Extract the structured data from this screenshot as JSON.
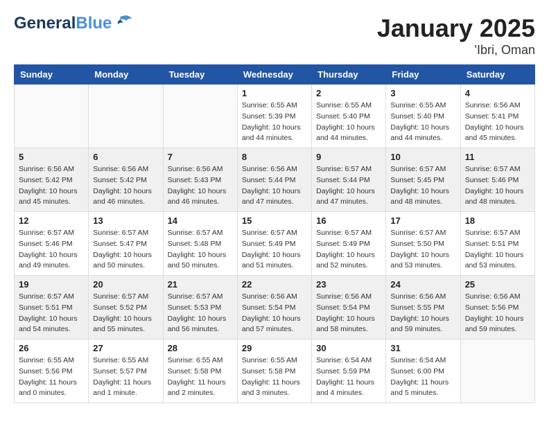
{
  "header": {
    "logo_general": "General",
    "logo_blue": "Blue",
    "month": "January 2025",
    "location": "'Ibri, Oman"
  },
  "weekdays": [
    "Sunday",
    "Monday",
    "Tuesday",
    "Wednesday",
    "Thursday",
    "Friday",
    "Saturday"
  ],
  "weeks": [
    [
      {
        "day": "",
        "info": ""
      },
      {
        "day": "",
        "info": ""
      },
      {
        "day": "",
        "info": ""
      },
      {
        "day": "1",
        "info": "Sunrise: 6:55 AM\nSunset: 5:39 PM\nDaylight: 10 hours\nand 44 minutes."
      },
      {
        "day": "2",
        "info": "Sunrise: 6:55 AM\nSunset: 5:40 PM\nDaylight: 10 hours\nand 44 minutes."
      },
      {
        "day": "3",
        "info": "Sunrise: 6:55 AM\nSunset: 5:40 PM\nDaylight: 10 hours\nand 44 minutes."
      },
      {
        "day": "4",
        "info": "Sunrise: 6:56 AM\nSunset: 5:41 PM\nDaylight: 10 hours\nand 45 minutes."
      }
    ],
    [
      {
        "day": "5",
        "info": "Sunrise: 6:56 AM\nSunset: 5:42 PM\nDaylight: 10 hours\nand 45 minutes."
      },
      {
        "day": "6",
        "info": "Sunrise: 6:56 AM\nSunset: 5:42 PM\nDaylight: 10 hours\nand 46 minutes."
      },
      {
        "day": "7",
        "info": "Sunrise: 6:56 AM\nSunset: 5:43 PM\nDaylight: 10 hours\nand 46 minutes."
      },
      {
        "day": "8",
        "info": "Sunrise: 6:56 AM\nSunset: 5:44 PM\nDaylight: 10 hours\nand 47 minutes."
      },
      {
        "day": "9",
        "info": "Sunrise: 6:57 AM\nSunset: 5:44 PM\nDaylight: 10 hours\nand 47 minutes."
      },
      {
        "day": "10",
        "info": "Sunrise: 6:57 AM\nSunset: 5:45 PM\nDaylight: 10 hours\nand 48 minutes."
      },
      {
        "day": "11",
        "info": "Sunrise: 6:57 AM\nSunset: 5:46 PM\nDaylight: 10 hours\nand 48 minutes."
      }
    ],
    [
      {
        "day": "12",
        "info": "Sunrise: 6:57 AM\nSunset: 5:46 PM\nDaylight: 10 hours\nand 49 minutes."
      },
      {
        "day": "13",
        "info": "Sunrise: 6:57 AM\nSunset: 5:47 PM\nDaylight: 10 hours\nand 50 minutes."
      },
      {
        "day": "14",
        "info": "Sunrise: 6:57 AM\nSunset: 5:48 PM\nDaylight: 10 hours\nand 50 minutes."
      },
      {
        "day": "15",
        "info": "Sunrise: 6:57 AM\nSunset: 5:49 PM\nDaylight: 10 hours\nand 51 minutes."
      },
      {
        "day": "16",
        "info": "Sunrise: 6:57 AM\nSunset: 5:49 PM\nDaylight: 10 hours\nand 52 minutes."
      },
      {
        "day": "17",
        "info": "Sunrise: 6:57 AM\nSunset: 5:50 PM\nDaylight: 10 hours\nand 53 minutes."
      },
      {
        "day": "18",
        "info": "Sunrise: 6:57 AM\nSunset: 5:51 PM\nDaylight: 10 hours\nand 53 minutes."
      }
    ],
    [
      {
        "day": "19",
        "info": "Sunrise: 6:57 AM\nSunset: 5:51 PM\nDaylight: 10 hours\nand 54 minutes."
      },
      {
        "day": "20",
        "info": "Sunrise: 6:57 AM\nSunset: 5:52 PM\nDaylight: 10 hours\nand 55 minutes."
      },
      {
        "day": "21",
        "info": "Sunrise: 6:57 AM\nSunset: 5:53 PM\nDaylight: 10 hours\nand 56 minutes."
      },
      {
        "day": "22",
        "info": "Sunrise: 6:56 AM\nSunset: 5:54 PM\nDaylight: 10 hours\nand 57 minutes."
      },
      {
        "day": "23",
        "info": "Sunrise: 6:56 AM\nSunset: 5:54 PM\nDaylight: 10 hours\nand 58 minutes."
      },
      {
        "day": "24",
        "info": "Sunrise: 6:56 AM\nSunset: 5:55 PM\nDaylight: 10 hours\nand 59 minutes."
      },
      {
        "day": "25",
        "info": "Sunrise: 6:56 AM\nSunset: 5:56 PM\nDaylight: 10 hours\nand 59 minutes."
      }
    ],
    [
      {
        "day": "26",
        "info": "Sunrise: 6:55 AM\nSunset: 5:56 PM\nDaylight: 11 hours\nand 0 minutes."
      },
      {
        "day": "27",
        "info": "Sunrise: 6:55 AM\nSunset: 5:57 PM\nDaylight: 11 hours\nand 1 minute."
      },
      {
        "day": "28",
        "info": "Sunrise: 6:55 AM\nSunset: 5:58 PM\nDaylight: 11 hours\nand 2 minutes."
      },
      {
        "day": "29",
        "info": "Sunrise: 6:55 AM\nSunset: 5:58 PM\nDaylight: 11 hours\nand 3 minutes."
      },
      {
        "day": "30",
        "info": "Sunrise: 6:54 AM\nSunset: 5:59 PM\nDaylight: 11 hours\nand 4 minutes."
      },
      {
        "day": "31",
        "info": "Sunrise: 6:54 AM\nSunset: 6:00 PM\nDaylight: 11 hours\nand 5 minutes."
      },
      {
        "day": "",
        "info": ""
      }
    ]
  ]
}
